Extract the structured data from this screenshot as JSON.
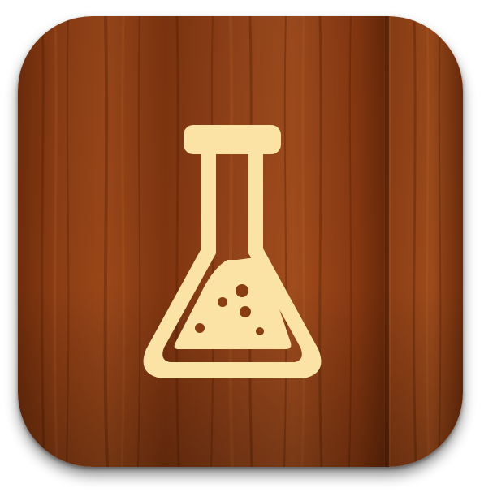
{
  "app_icon": {
    "icon_name": "flask-icon",
    "background": "wood",
    "colors": {
      "wood_base": "#8a3e12",
      "wood_dark": "#5a2406",
      "wood_light": "#a8541f",
      "glyph": "#fbe3a6"
    }
  }
}
